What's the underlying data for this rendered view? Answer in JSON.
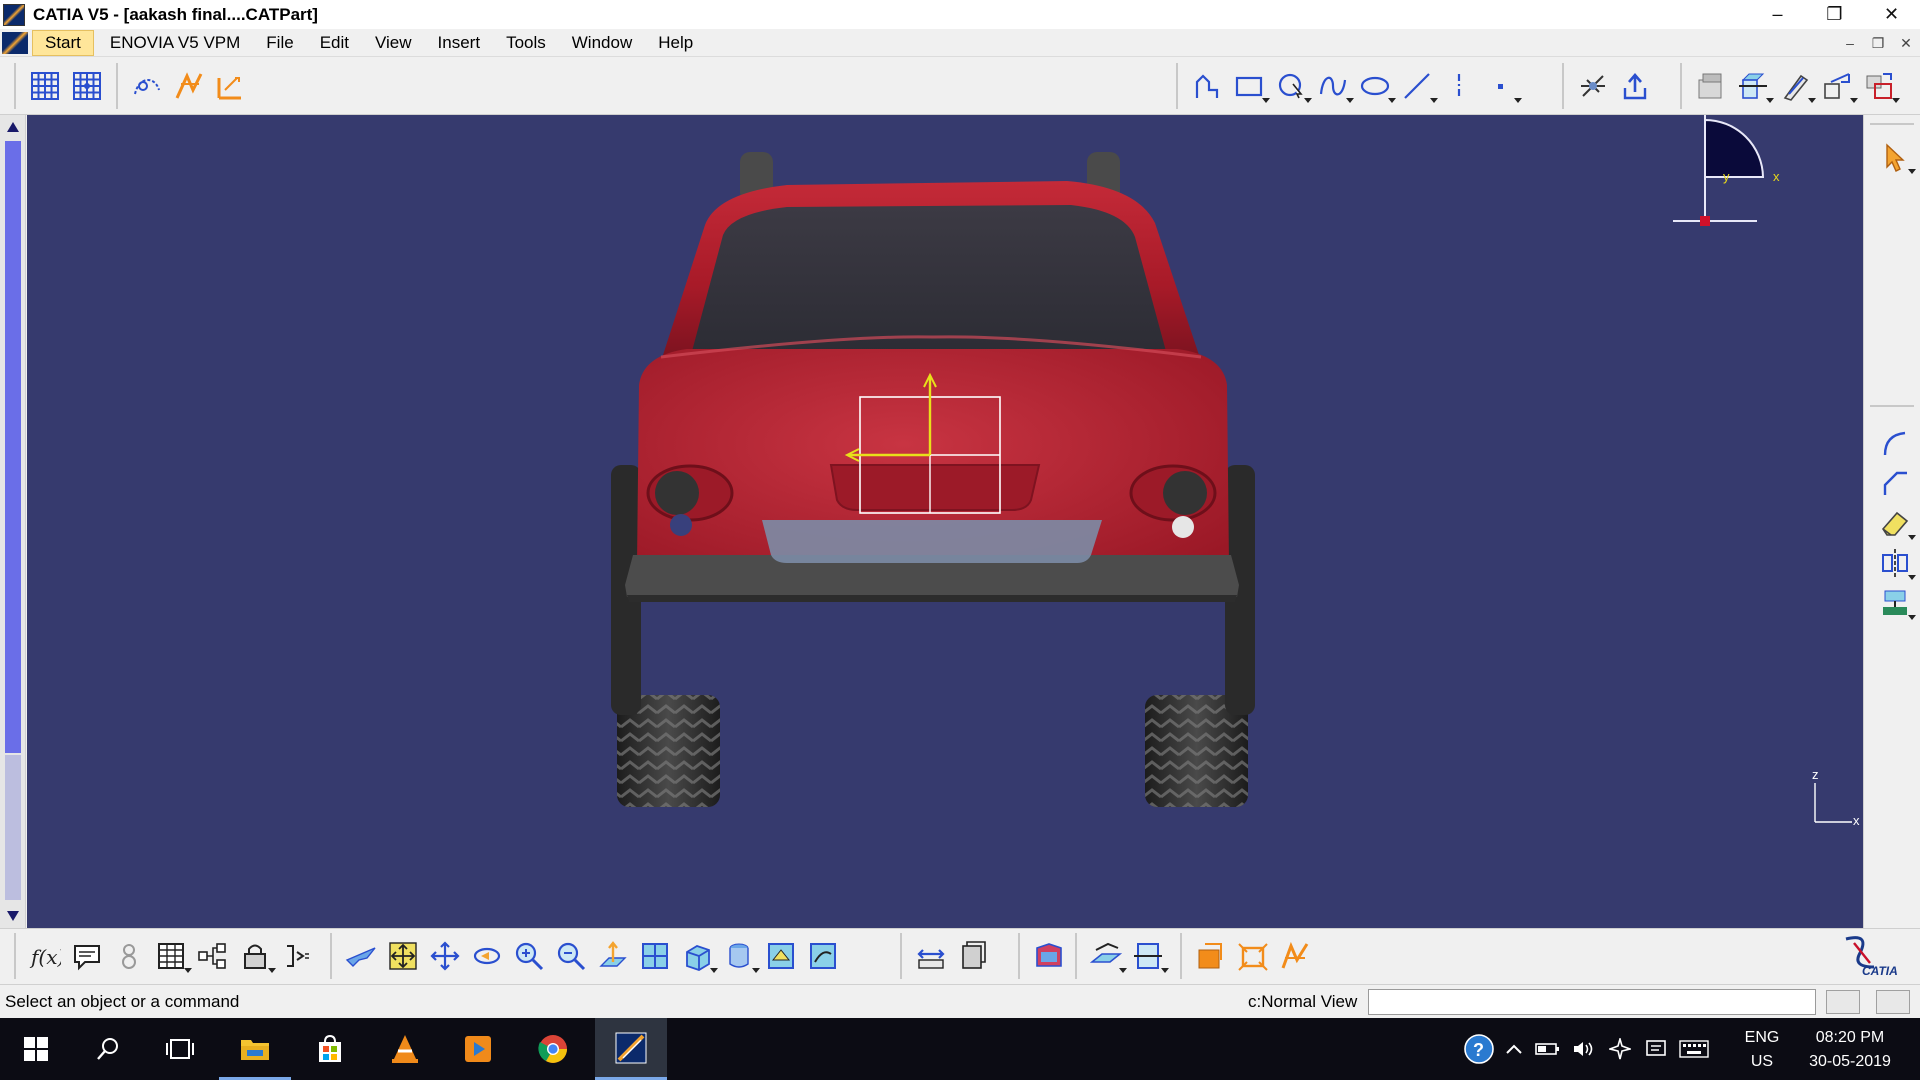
{
  "window": {
    "title": "CATIA V5 - [aakash final....CATPart]",
    "minimize": "–",
    "restore": "❐",
    "close": "✕"
  },
  "menu": {
    "items": [
      {
        "label": "Start"
      },
      {
        "label": "ENOVIA V5 VPM"
      },
      {
        "label": "File"
      },
      {
        "label": "Edit"
      },
      {
        "label": "View"
      },
      {
        "label": "Insert"
      },
      {
        "label": "Tools"
      },
      {
        "label": "Window"
      },
      {
        "label": "Help"
      }
    ],
    "doc_minimize": "–",
    "doc_restore": "❐",
    "doc_close": "✕"
  },
  "viewport": {
    "background": "#363a6e",
    "car_color": "#b3202e",
    "compass_labels": {
      "z": "z",
      "x": "x",
      "y": "y"
    },
    "axis_labels": {
      "z": "z",
      "x": "x"
    }
  },
  "statusbar": {
    "message": "Select an object or a command",
    "view": "c:Normal View",
    "command_value": ""
  },
  "taskbar": {
    "language_line1": "ENG",
    "language_line2": "US",
    "time": "08:20 PM",
    "date": "30-05-2019"
  },
  "logo": {
    "brand": "CATIA"
  }
}
